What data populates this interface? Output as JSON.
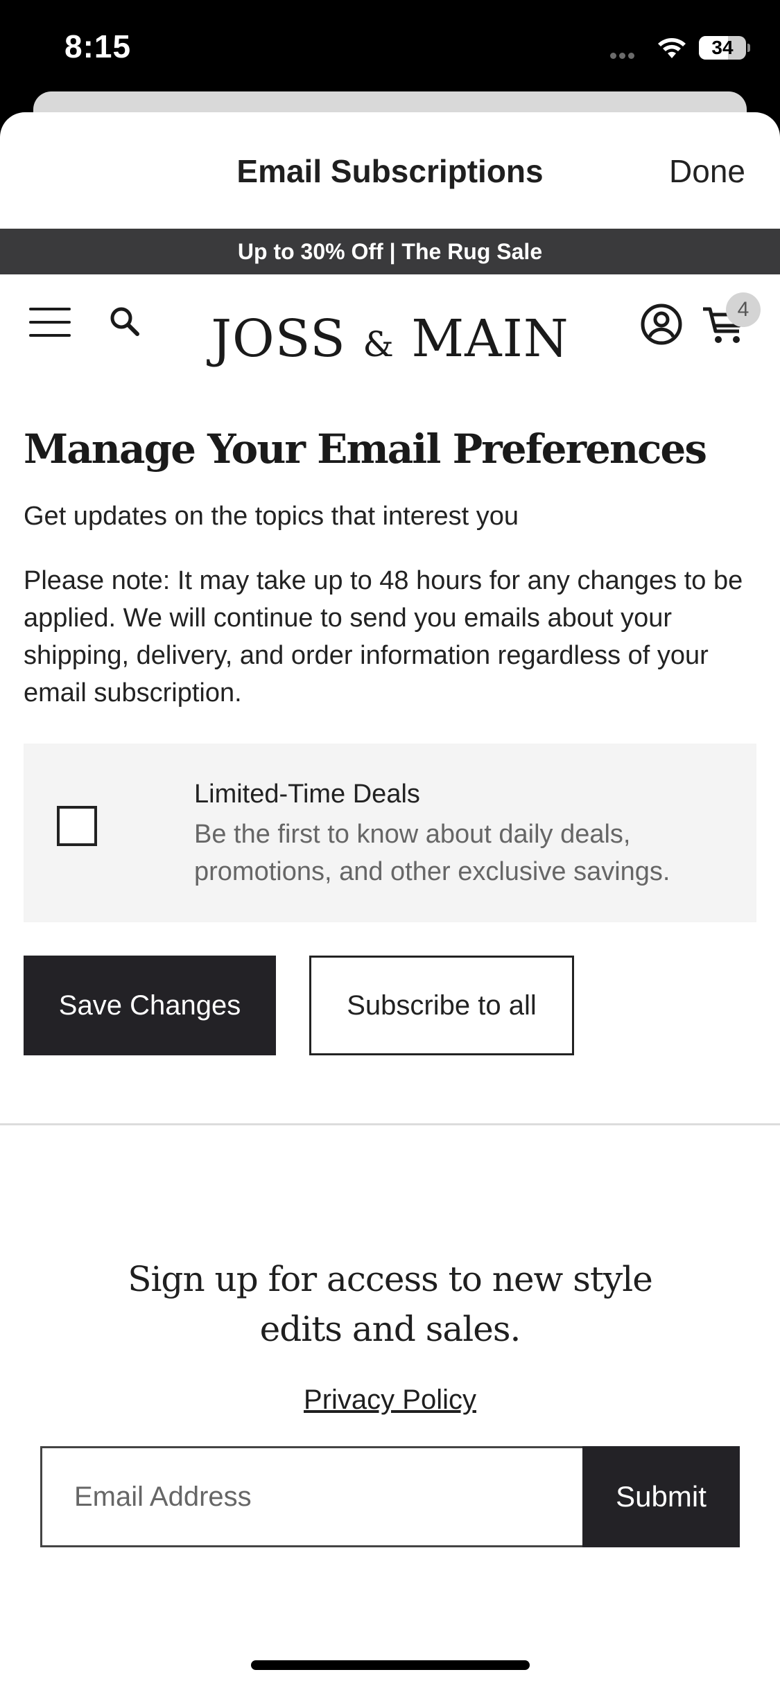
{
  "status_bar": {
    "time": "8:15",
    "battery": "34"
  },
  "sheet": {
    "title": "Email Subscriptions",
    "done_label": "Done"
  },
  "promo_banner": "Up to 30% Off | The Rug Sale",
  "nav": {
    "brand_left": "JOSS",
    "brand_amp": "&",
    "brand_right": "MAIN",
    "cart_count": "4"
  },
  "page": {
    "title": "Manage Your Email Preferences",
    "subtitle": "Get updates on the topics that interest you",
    "note": "Please note: It may take up to 48 hours for any changes to be applied. We will continue to send you emails about your shipping, delivery, and order information regardless of your email subscription."
  },
  "preferences": [
    {
      "label": "Limited-Time Deals",
      "description": "Be the first to know about daily deals, promotions, and other exclusive savings.",
      "checked": false
    }
  ],
  "actions": {
    "save_label": "Save Changes",
    "subscribe_label": "Subscribe to all"
  },
  "signup": {
    "heading": "Sign up for access to new style edits and sales.",
    "privacy_label": "Privacy Policy",
    "email_placeholder": "Email Address",
    "submit_label": "Submit"
  }
}
